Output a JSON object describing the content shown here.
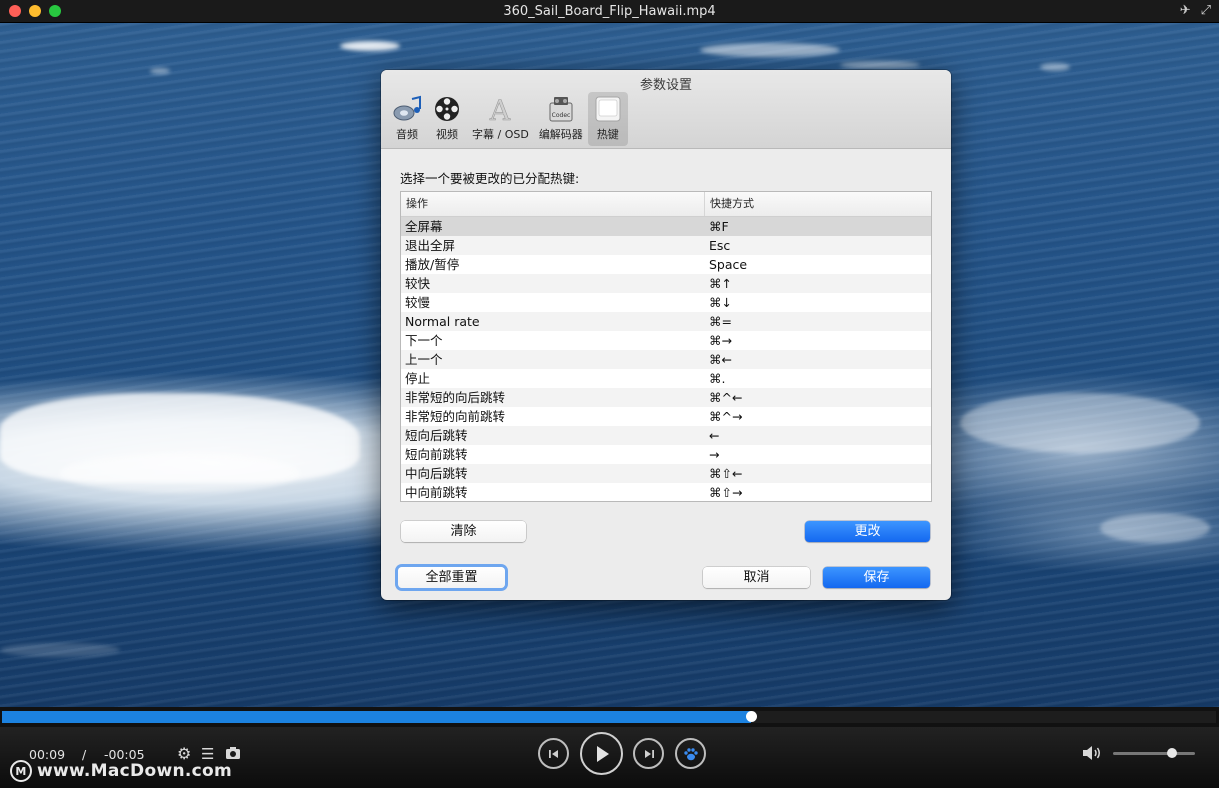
{
  "window": {
    "title": "360_Sail_Board_Flip_Hawaii.mp4"
  },
  "dialog": {
    "title": "参数设置",
    "tabs": [
      {
        "label": "音频",
        "icon": "audio-icon"
      },
      {
        "label": "视频",
        "icon": "film-reel-icon"
      },
      {
        "label": "字幕 / OSD",
        "icon": "letter-a-icon"
      },
      {
        "label": "编解码器",
        "icon": "codec-box-icon"
      },
      {
        "label": "热键",
        "icon": "keyboard-key-icon",
        "selected": true
      }
    ],
    "prompt": "选择一个要被更改的已分配热键:",
    "table": {
      "headers": [
        "操作",
        "快捷方式"
      ],
      "rows": [
        {
          "action": "全屏幕",
          "shortcut": "⌘F",
          "selected": true
        },
        {
          "action": "退出全屏",
          "shortcut": "Esc"
        },
        {
          "action": "播放/暂停",
          "shortcut": "Space"
        },
        {
          "action": "较快",
          "shortcut": "⌘↑"
        },
        {
          "action": "较慢",
          "shortcut": "⌘↓"
        },
        {
          "action": "Normal rate",
          "shortcut": "⌘="
        },
        {
          "action": "下一个",
          "shortcut": "⌘→"
        },
        {
          "action": "上一个",
          "shortcut": "⌘←"
        },
        {
          "action": "停止",
          "shortcut": "⌘."
        },
        {
          "action": "非常短的向后跳转",
          "shortcut": "⌘^←"
        },
        {
          "action": "非常短的向前跳转",
          "shortcut": "⌘^→"
        },
        {
          "action": "短向后跳转",
          "shortcut": "←"
        },
        {
          "action": "短向前跳转",
          "shortcut": "→"
        },
        {
          "action": "中向后跳转",
          "shortcut": "⌘⇧←"
        },
        {
          "action": "中向前跳转",
          "shortcut": "⌘⇧→"
        }
      ]
    },
    "buttons": {
      "clear": "清除",
      "change": "更改",
      "reset_all": "全部重置",
      "cancel": "取消",
      "save": "保存"
    }
  },
  "player": {
    "elapsed": "00:09",
    "separator": "/",
    "remaining": "-00:05",
    "progress_fraction": 0.617,
    "volume_fraction": 0.72,
    "accent_color": "#1c82e0"
  },
  "watermark": "www.MacDown.com"
}
